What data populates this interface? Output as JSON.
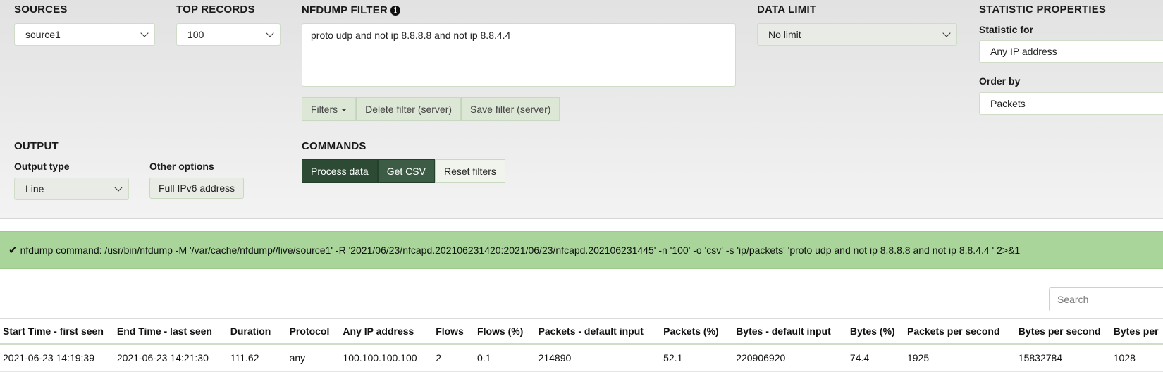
{
  "sources": {
    "title": "SOURCES",
    "value": "source1"
  },
  "top_records": {
    "title": "TOP RECORDS",
    "value": "100"
  },
  "filter": {
    "title": "NFDUMP FILTER",
    "icon": "info-icon",
    "value": "proto udp and not ip 8.8.8.8 and not ip 8.8.4.4",
    "buttons": {
      "filters": "Filters",
      "delete": "Delete filter (server)",
      "save": "Save filter (server)"
    }
  },
  "data_limit": {
    "title": "DATA LIMIT",
    "value": "No limit"
  },
  "statistic": {
    "title": "STATISTIC PROPERTIES",
    "statistic_for_label": "Statistic for",
    "statistic_for_value": "Any IP address",
    "order_by_label": "Order by",
    "order_by_value": "Packets"
  },
  "output": {
    "title": "OUTPUT",
    "output_type_label": "Output type",
    "output_type_value": "Line",
    "other_options_label": "Other options",
    "ipv6_button": "Full IPv6 address"
  },
  "commands": {
    "title": "COMMANDS",
    "process": "Process data",
    "csv": "Get CSV",
    "reset": "Reset filters"
  },
  "alert": {
    "icon": "check-icon",
    "text": "nfdump command: /usr/bin/nfdump -M '/var/cache/nfdump//live/source1' -R '2021/06/23/nfcapd.202106231420:2021/06/23/nfcapd.202106231445' -n '100' -o 'csv' -s 'ip/packets' 'proto udp and not ip 8.8.8.8 and not ip 8.8.4.4 ' 2>&1",
    "color": "#a9d49a"
  },
  "search": {
    "placeholder": "Search"
  },
  "table": {
    "headers": [
      "Start Time - first seen",
      "End Time - last seen",
      "Duration",
      "Protocol",
      "Any IP address",
      "Flows",
      "Flows (%)",
      "Packets - default input",
      "Packets (%)",
      "Bytes - default input",
      "Bytes (%)",
      "Packets per second",
      "Bytes per second",
      "Bytes per"
    ],
    "rows": [
      [
        "2021-06-23 14:19:39",
        "2021-06-23 14:21:30",
        "111.62",
        "any",
        "100.100.100.100",
        "2",
        "0.1",
        "214890",
        "52.1",
        "220906920",
        "74.4",
        "1925",
        "15832784",
        "1028"
      ]
    ]
  },
  "colors": {
    "dark_button": "#2d4a35",
    "button_group": "#dde7d6"
  }
}
